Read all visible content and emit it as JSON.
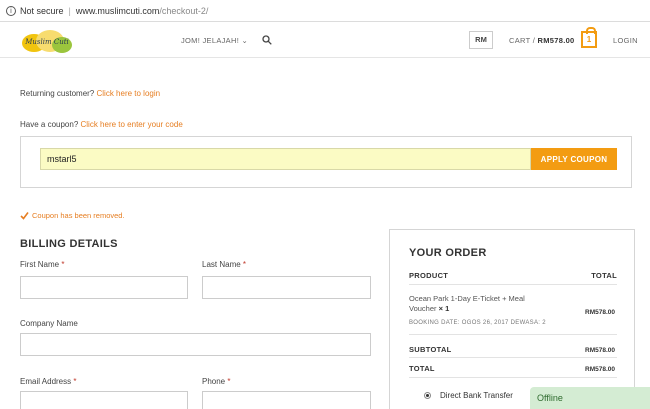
{
  "browser": {
    "security_label": "Not secure",
    "url_host": "www.muslimcuti.com",
    "url_path": "/checkout-2/"
  },
  "header": {
    "logo_text": "Muslim Cuti",
    "nav_item": "JOM! JELAJAH!",
    "nav_chevron": "⌄",
    "currency": "RM",
    "cart_label": "CART /",
    "cart_total": "RM578.00",
    "cart_count": "1",
    "login": "LOGIN"
  },
  "notices": {
    "returning_text": "Returning customer?",
    "returning_link": "Click here to login",
    "coupon_text": "Have a coupon?",
    "coupon_link": "Click here to enter your code"
  },
  "coupon": {
    "value": "mstarl5",
    "button": "APPLY COUPON"
  },
  "message": {
    "removed": "Coupon has been removed."
  },
  "billing": {
    "title": "BILLING DETAILS",
    "first_name": "First Name",
    "last_name": "Last Name",
    "company": "Company Name",
    "email": "Email Address",
    "phone": "Phone",
    "required_mark": "*"
  },
  "order": {
    "title": "YOUR ORDER",
    "col_product": "PRODUCT",
    "col_total": "TOTAL",
    "item_name": "Ocean Park 1-Day E-Ticket + Meal Voucher",
    "item_qty": "× 1",
    "item_meta_date_label": "BOOKING DATE:",
    "item_meta_date": "OGOS 26, 2017",
    "item_meta_adult_label": "DEWASA:",
    "item_meta_adult": "2",
    "item_price": "RM578.00",
    "subtotal_label": "SUBTOTAL",
    "subtotal": "RM578.00",
    "total_label": "TOTAL",
    "total": "RM578.00",
    "payment_method": "Direct Bank Transfer"
  },
  "chat": {
    "status": "Offline"
  },
  "colors": {
    "accent": "#f39c12",
    "link": "#e67e22",
    "coupon_field_bg": "#fbfbc4",
    "chat_bg": "#d4ecd3"
  }
}
